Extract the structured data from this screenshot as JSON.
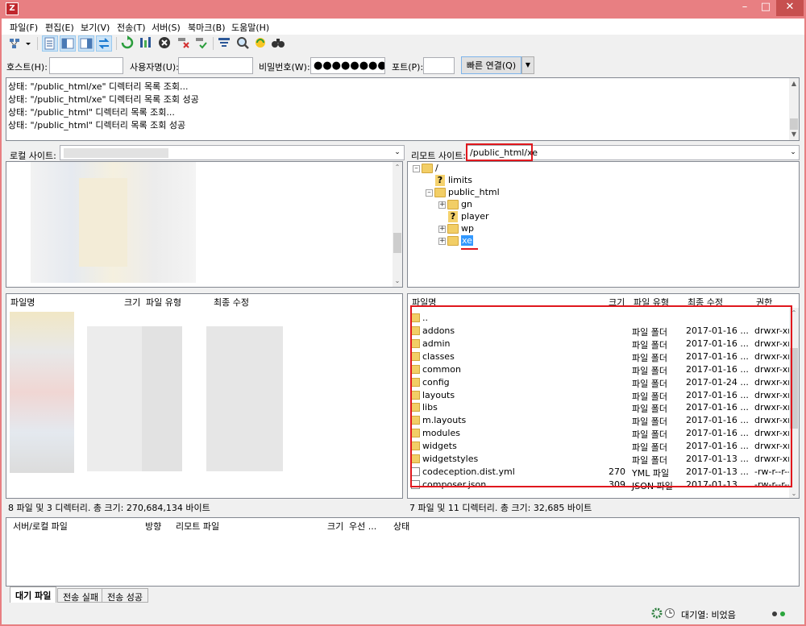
{
  "menu": [
    "파일(F)",
    "편집(E)",
    "보기(V)",
    "전송(T)",
    "서버(S)",
    "북마크(B)",
    "도움말(H)"
  ],
  "quickconnect": {
    "host_label": "호스트(H):",
    "user_label": "사용자명(U):",
    "pass_label": "비밀번호(W):",
    "pass_value": "●●●●●●●●●●",
    "port_label": "포트(P):",
    "connect_label": "빠른 연결(Q)"
  },
  "log": [
    "상태:   \"/public_html/xe\" 디렉터리 목록 조회...",
    "상태:   \"/public_html/xe\" 디렉터리 목록 조회 성공",
    "상태:   \"/public_html\" 디렉터리 목록 조회...",
    "상태:   \"/public_html\" 디렉터리 목록 조회 성공"
  ],
  "local": {
    "site_label": "로컬 사이트:",
    "columns": [
      "파일명",
      "크기",
      "파일 유형",
      "최종 수정"
    ],
    "status": "8 파일 및 3 디렉터리. 총 크기: 270,684,134 바이트"
  },
  "remote": {
    "site_label": "리모트 사이트:",
    "path": "/public_html/xe",
    "tree": {
      "root": "/",
      "limits": "limits",
      "public_html": "public_html",
      "gn": "gn",
      "player": "player",
      "wp": "wp",
      "xe": "xe"
    },
    "columns": [
      "파일명",
      "크기",
      "파일 유형",
      "최종 수정",
      "권한"
    ],
    "parent": "..",
    "files": [
      {
        "name": "addons",
        "size": "",
        "type": "파일 폴더",
        "modified": "2017-01-16 ...",
        "perms": "drwxr-xr-x",
        "folder": true
      },
      {
        "name": "admin",
        "size": "",
        "type": "파일 폴더",
        "modified": "2017-01-16 ...",
        "perms": "drwxr-xr-x",
        "folder": true
      },
      {
        "name": "classes",
        "size": "",
        "type": "파일 폴더",
        "modified": "2017-01-16 ...",
        "perms": "drwxr-xr-x",
        "folder": true
      },
      {
        "name": "common",
        "size": "",
        "type": "파일 폴더",
        "modified": "2017-01-16 ...",
        "perms": "drwxr-xr-x",
        "folder": true
      },
      {
        "name": "config",
        "size": "",
        "type": "파일 폴더",
        "modified": "2017-01-24 ...",
        "perms": "drwxr-xr-x",
        "folder": true
      },
      {
        "name": "layouts",
        "size": "",
        "type": "파일 폴더",
        "modified": "2017-01-16 ...",
        "perms": "drwxr-xr-x",
        "folder": true
      },
      {
        "name": "libs",
        "size": "",
        "type": "파일 폴더",
        "modified": "2017-01-16 ...",
        "perms": "drwxr-xr-x",
        "folder": true
      },
      {
        "name": "m.layouts",
        "size": "",
        "type": "파일 폴더",
        "modified": "2017-01-16 ...",
        "perms": "drwxr-xr-x",
        "folder": true
      },
      {
        "name": "modules",
        "size": "",
        "type": "파일 폴더",
        "modified": "2017-01-16 ...",
        "perms": "drwxr-xr-x",
        "folder": true
      },
      {
        "name": "widgets",
        "size": "",
        "type": "파일 폴더",
        "modified": "2017-01-16 ...",
        "perms": "drwxr-xr-x",
        "folder": true
      },
      {
        "name": "widgetstyles",
        "size": "",
        "type": "파일 폴더",
        "modified": "2017-01-13 ...",
        "perms": "drwxr-xr-x",
        "folder": true
      },
      {
        "name": "codeception.dist.yml",
        "size": "270",
        "type": "YML 파일",
        "modified": "2017-01-13 ...",
        "perms": "-rw-r--r--",
        "folder": false
      },
      {
        "name": "composer.json",
        "size": "309",
        "type": "JSON 파일",
        "modified": "2017-01-13 ...",
        "perms": "-rw-r--r--",
        "folder": false
      }
    ],
    "status": "7 파일 및 11 디렉터리. 총 크기: 32,685 바이트"
  },
  "queue": {
    "columns": [
      "서버/로컬 파일",
      "방향",
      "리모트 파일",
      "크기",
      "우선 ...",
      "상태"
    ],
    "tabs": [
      "대기 파일",
      "전송 실패",
      "전송 성공"
    ]
  },
  "statusbar": {
    "queue_label": "대기열: 비었음"
  },
  "colors": {
    "titlebar": "#e87f82",
    "highlight": "#e0171d",
    "folder": "#f2ce66",
    "selection": "#3399ff"
  }
}
